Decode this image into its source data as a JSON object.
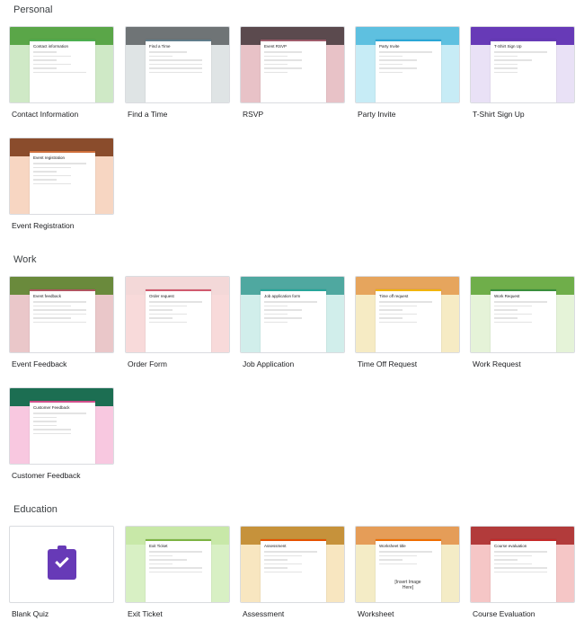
{
  "sections": {
    "personal": "Personal",
    "work": "Work",
    "education": "Education"
  },
  "personal": [
    {
      "label": "Contact Information",
      "sheet_title": "Contact information",
      "top": "#5aa648",
      "bottom": "#cfe9c6",
      "accent": "#4caf50"
    },
    {
      "label": "Find a Time",
      "sheet_title": "Find a Time",
      "top": "#6f7476",
      "bottom": "#dfe4e5",
      "accent": "#607d8b"
    },
    {
      "label": "RSVP",
      "sheet_title": "Event RSVP",
      "top": "#5b4a4e",
      "bottom": "#e8c2c7",
      "accent": "#9e5b6b"
    },
    {
      "label": "Party Invite",
      "sheet_title": "Party Invite",
      "top": "#5ec0e0",
      "bottom": "#c7ecf6",
      "accent": "#29a6d6"
    },
    {
      "label": "T-Shirt Sign Up",
      "sheet_title": "T-Shirt Sign Up",
      "top": "#673ab7",
      "bottom": "#e9e1f6",
      "accent": "#673ab7"
    }
  ],
  "personal_row2": [
    {
      "label": "Event Registration",
      "sheet_title": "Event registration",
      "top": "#8a4c2c",
      "bottom": "#f7d6c2",
      "accent": "#d0703c"
    }
  ],
  "work": [
    {
      "label": "Event Feedback",
      "sheet_title": "Event feedback",
      "top": "#6a8a3c",
      "bottom": "#eac7c9",
      "accent": "#b0545f"
    },
    {
      "label": "Order Form",
      "sheet_title": "Order request",
      "top": "#f3d8d8",
      "bottom": "#f8dada",
      "accent": "#d05a6e"
    },
    {
      "label": "Job Application",
      "sheet_title": "Job application form",
      "top": "#4fa8a0",
      "bottom": "#d1eeeb",
      "accent": "#26a69a"
    },
    {
      "label": "Time Off Request",
      "sheet_title": "Time off request",
      "top": "#e6a55d",
      "bottom": "#f6ebc4",
      "accent": "#f2b400"
    },
    {
      "label": "Work Request",
      "sheet_title": "Work Request",
      "top": "#6fae4a",
      "bottom": "#e5f3d8",
      "accent": "#388e3c"
    }
  ],
  "work_row2": [
    {
      "label": "Customer Feedback",
      "sheet_title": "Customer Feedback",
      "top": "#1c6e52",
      "bottom": "#f8c8e0",
      "accent": "#d04f8b"
    }
  ],
  "education": [
    {
      "label": "Blank Quiz"
    },
    {
      "label": "Exit Ticket",
      "sheet_title": "Exit Ticket",
      "top": "#c8e8a8",
      "bottom": "#d8f0c4",
      "accent": "#7cb342"
    },
    {
      "label": "Assessment",
      "sheet_title": "Assessment",
      "top": "#c6923b",
      "bottom": "#f8e6c0",
      "accent": "#e65100"
    },
    {
      "label": "Worksheet",
      "sheet_title": "Worksheet title",
      "image_text": "[Insert Image Here]",
      "top": "#e59d58",
      "bottom": "#f4ecc6",
      "accent": "#ef6c00"
    },
    {
      "label": "Course Evaluation",
      "sheet_title": "Course evaluation",
      "top": "#b23b3b",
      "bottom": "#f5c6c6",
      "accent": "#c62828"
    }
  ]
}
